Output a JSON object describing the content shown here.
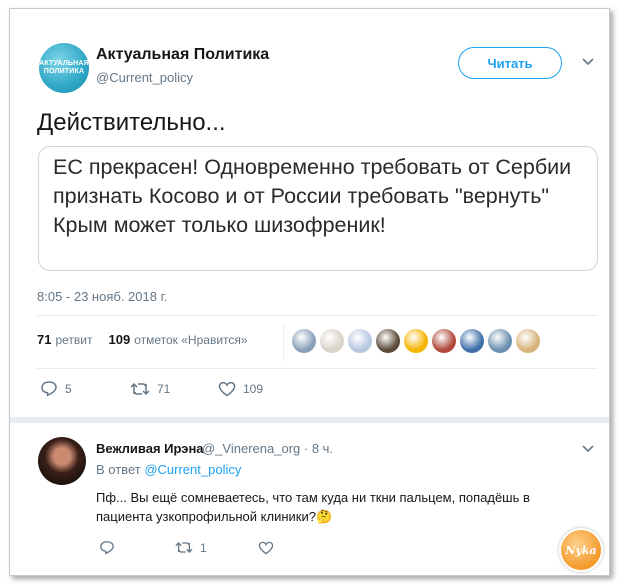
{
  "account": {
    "avatar_text": "АКТУАЛЬНАЯ ПОЛИТИКА",
    "name": "Актуальная Политика",
    "handle": "@Current_policy",
    "follow_label": "Читать"
  },
  "tweet": {
    "text": "Действительно...",
    "quote": "ЕС прекрасен! Одновременно требовать от Сербии признать Косово и от России требовать \"вернуть\" Крым может только шизофреник!",
    "timestamp": "8:05 - 23 нояб. 2018 г."
  },
  "stats": {
    "retweets_count": "71",
    "retweets_label": "ретвит",
    "likes_count": "109",
    "likes_label": "отметок «Нравится»",
    "liker_colors": [
      "#8aa0b8",
      "#d9d2c8",
      "#b7c7e0",
      "#5c4a3a",
      "#f5b400",
      "#b0483a",
      "#3f6fa8",
      "#6b8fb0",
      "#d8b27a"
    ]
  },
  "actions": {
    "replies": "5",
    "retweets": "71",
    "likes": "109"
  },
  "reply": {
    "name": "Вежливая Ирэна",
    "handle": "@_Vinerena_org",
    "time": "· 8 ч.",
    "in_reply_prefix": "В ответ",
    "in_reply_handle": "@Current_policy",
    "text": "Пф... Вы ещё сомневаетесь, что там куда ни ткни пальцем, попадёшь в пациента узкопрофильной клиники?🤔",
    "retweets": "1"
  },
  "watermark": {
    "text": "Nyka"
  }
}
